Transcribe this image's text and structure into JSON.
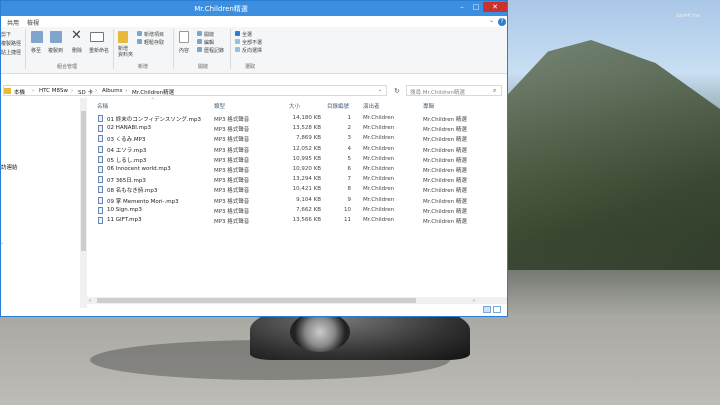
{
  "window": {
    "title": "Mr.Children精選"
  },
  "menu_tabs": [
    "共用",
    "檢視"
  ],
  "ribbon": {
    "left_texts": [
      "剪下",
      "複製路徑",
      "貼上捷徑"
    ],
    "buttons": {
      "move_to": "移至",
      "copy_to": "複製到",
      "delete": "刪除",
      "rename": "重新命名",
      "new_folder": "新增\n資料夾",
      "properties": "內容"
    },
    "new": {
      "new_item": "新增項目",
      "easy_access": "輕鬆存取"
    },
    "open": {
      "open": "開啟",
      "edit": "編輯",
      "history": "歷程記錄"
    },
    "select": {
      "select_all": "全選",
      "select_none": "全部不選",
      "invert": "反向選擇"
    },
    "groups": {
      "organize": "組合管理",
      "new": "新增",
      "open": "開啟",
      "select": "選取"
    }
  },
  "address": {
    "breadcrumbs": [
      "本機",
      "HTC M8Sw",
      "SD 卡",
      "Albums",
      "Mr.Children精選"
    ],
    "search_placeholder": "搜尋 Mr.Children精選"
  },
  "nav": {
    "items": [
      "訪連結"
    ]
  },
  "columns": {
    "name": "名稱",
    "type": "類型",
    "size": "大小",
    "track": "目錄編號",
    "artist": "演出者",
    "album": "專輯"
  },
  "files": [
    {
      "name": "01 終末のコンフィデンスソング.mp3",
      "type": "MP3 格式聲音",
      "size": "14,180 KB",
      "track": "1",
      "artist": "Mr.Children",
      "album": "Mr.Children 精選"
    },
    {
      "name": "02 HANABI.mp3",
      "type": "MP3 格式聲音",
      "size": "13,528 KB",
      "track": "2",
      "artist": "Mr.Children",
      "album": "Mr.Children 精選"
    },
    {
      "name": "03 くるみ.MP3",
      "type": "MP3 格式聲音",
      "size": "7,869 KB",
      "track": "3",
      "artist": "Mr.Children",
      "album": "Mr.Children 精選"
    },
    {
      "name": "04 エソラ.mp3",
      "type": "MP3 格式聲音",
      "size": "12,052 KB",
      "track": "4",
      "artist": "Mr.Children",
      "album": "Mr.Children 精選"
    },
    {
      "name": "05 しるし.mp3",
      "type": "MP3 格式聲音",
      "size": "10,995 KB",
      "track": "5",
      "artist": "Mr.Children",
      "album": "Mr.Children 精選"
    },
    {
      "name": "06 Innocent world.mp3",
      "type": "MP3 格式聲音",
      "size": "10,920 KB",
      "track": "6",
      "artist": "Mr.Children",
      "album": "Mr.Children 精選"
    },
    {
      "name": "07 365日.mp3",
      "type": "MP3 格式聲音",
      "size": "13,294 KB",
      "track": "7",
      "artist": "Mr.Children",
      "album": "Mr.Children 精選"
    },
    {
      "name": "08 名もなき詩.mp3",
      "type": "MP3 格式聲音",
      "size": "10,421 KB",
      "track": "8",
      "artist": "Mr.Children",
      "album": "Mr.Children 精選"
    },
    {
      "name": "09 掌 Memento Mori-.mp3",
      "type": "MP3 格式聲音",
      "size": "9,104 KB",
      "track": "9",
      "artist": "Mr.Children",
      "album": "Mr.Children 精選"
    },
    {
      "name": "10 Sign.mp3",
      "type": "MP3 格式聲音",
      "size": "7,662 KB",
      "track": "10",
      "artist": "Mr.Children",
      "album": "Mr.Children 精選"
    },
    {
      "name": "11 GIFT.mp3",
      "type": "MP3 格式聲音",
      "size": "13,566 KB",
      "track": "11",
      "artist": "Mr.Children",
      "album": "Mr.Children 精選"
    }
  ],
  "desktop": {
    "watermark": "dark4.me"
  },
  "colors": {
    "titlebar": "#3c8fe0",
    "accent": "#2b7cd3",
    "close": "#c7342d"
  }
}
